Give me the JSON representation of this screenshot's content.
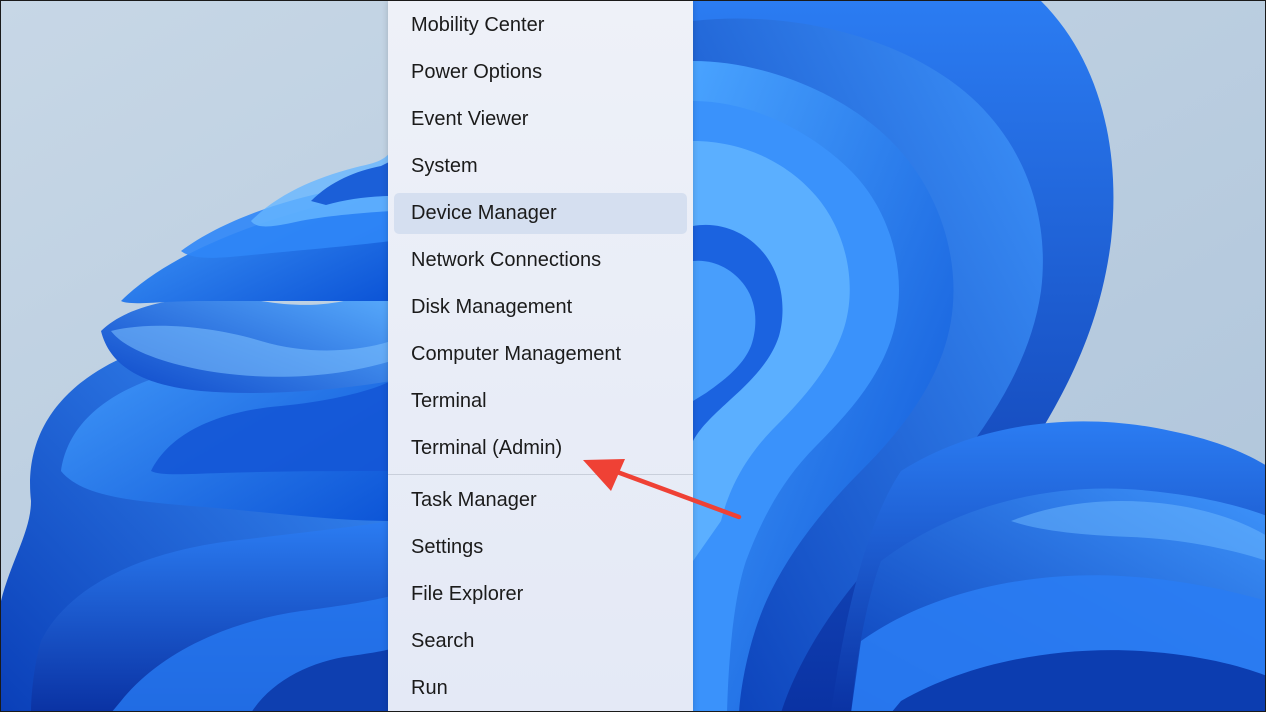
{
  "context_menu": {
    "items": [
      {
        "label": "Mobility Center"
      },
      {
        "label": "Power Options"
      },
      {
        "label": "Event Viewer"
      },
      {
        "label": "System"
      },
      {
        "label": "Device Manager"
      },
      {
        "label": "Network Connections"
      },
      {
        "label": "Disk Management"
      },
      {
        "label": "Computer Management"
      },
      {
        "label": "Terminal"
      },
      {
        "label": "Terminal (Admin)"
      },
      {
        "label": "Task Manager"
      },
      {
        "label": "Settings"
      },
      {
        "label": "File Explorer"
      },
      {
        "label": "Search"
      },
      {
        "label": "Run"
      }
    ],
    "highlighted_item": "Device Manager"
  },
  "annotation": {
    "type": "arrow",
    "points_to": "Terminal (Admin)",
    "color": "#ef4135"
  },
  "colors": {
    "wallpaper_background": "#b9cde0",
    "bloom_blue": "#1f6ff0",
    "menu_background": "#eaeef7",
    "menu_highlight": "#d5dff0"
  }
}
